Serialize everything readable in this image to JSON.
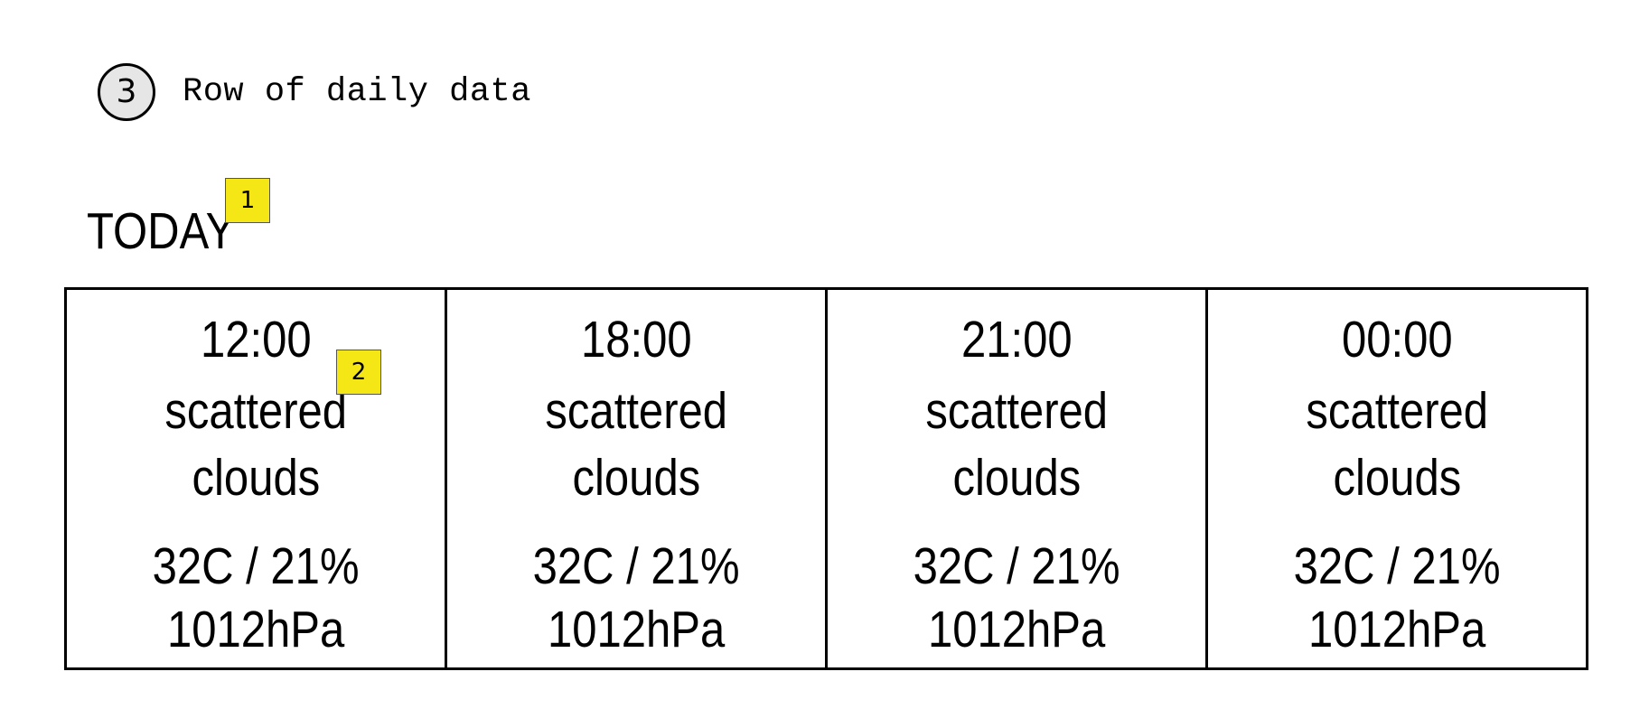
{
  "heading": {
    "step_number": "3",
    "text": "Row of daily data"
  },
  "section": {
    "title": "TODAY"
  },
  "markers": [
    "1",
    "2"
  ],
  "forecast": [
    {
      "time": "12:00",
      "weather_line1": "scattered",
      "weather_line2": "clouds",
      "temp_humidity": "32C / 21%",
      "pressure": "1012hPa"
    },
    {
      "time": "18:00",
      "weather_line1": "scattered",
      "weather_line2": "clouds",
      "temp_humidity": "32C / 21%",
      "pressure": "1012hPa"
    },
    {
      "time": "21:00",
      "weather_line1": "scattered",
      "weather_line2": "clouds",
      "temp_humidity": "32C / 21%",
      "pressure": "1012hPa"
    },
    {
      "time": "00:00",
      "weather_line1": "scattered",
      "weather_line2": "clouds",
      "temp_humidity": "32C / 21%",
      "pressure": "1012hPa"
    }
  ],
  "colors": {
    "marker_fill": "#f5e615",
    "step_circle_fill": "#e6e6e6",
    "border": "#000000"
  }
}
